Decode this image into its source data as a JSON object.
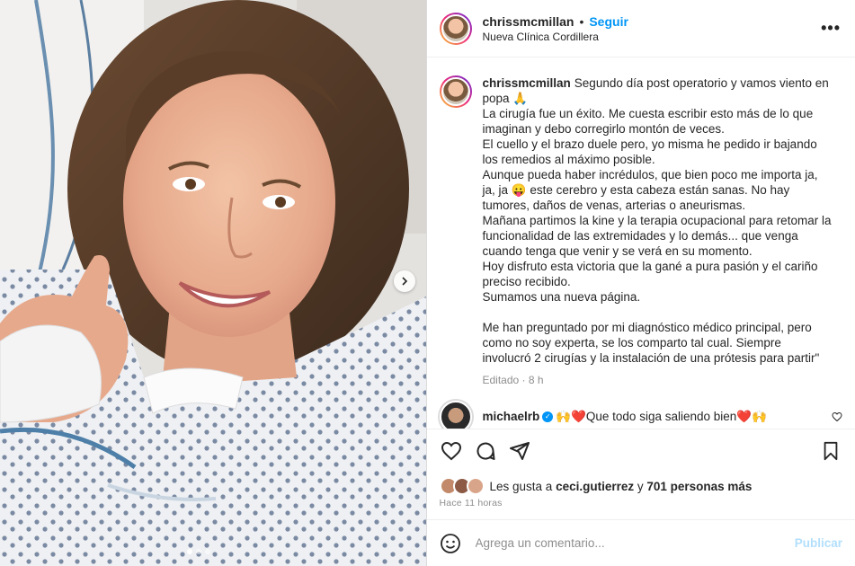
{
  "post": {
    "username": "chrissmcmillan",
    "separator": "•",
    "follow_label": "Seguir",
    "location": "Nueva Clínica Cordillera",
    "more_icon": "•••"
  },
  "caption": {
    "username": "chrissmcmillan",
    "paragraphs": [
      "Segundo día post operatorio y vamos viento en popa 🙏",
      "La cirugía fue un éxito. Me cuesta escribir esto más de lo que imaginan y debo corregirlo montón de veces.",
      "El cuello y el brazo duele pero, yo misma he pedido ir bajando los remedios al máximo posible.",
      "Aunque pueda haber incrédulos, que bien poco me importa ja, ja, ja 😛 este cerebro y esta cabeza están sanas. No hay tumores, daños de venas, arterias o aneurismas.",
      "Mañana partimos la kine y la terapia ocupacional para retomar la funcionalidad de las extremidades y lo demás... que venga cuando tenga que venir y se verá en su momento.",
      "Hoy disfruto esta victoria que la gané a pura pasión y el cariño preciso recibido.",
      "Sumamos una nueva página."
    ],
    "paragraphs2": [
      "Me han preguntado por mi diagnóstico médico principal, pero como no soy experta, se los comparto tal cual. Siempre involucró 2 cirugías y la instalación de una prótesis para partir\""
    ],
    "edited": "Editado · 8 h"
  },
  "comment": {
    "username": "michaelrb",
    "verified_icon": "✓",
    "text": "🙌❤️Que todo siga saliendo bien❤️🙌"
  },
  "likes": {
    "prefix": "Les gusta a ",
    "user": "ceci.gutierrez",
    "middle": " y ",
    "count": "701 personas más"
  },
  "time_ago": "Hace 11 horas",
  "add_comment": {
    "placeholder": "Agrega un comentario...",
    "publish_label": "Publicar"
  },
  "carousel": {
    "total_slides": 3,
    "active_slide": 1
  },
  "colors": {
    "follow": "#0095f6",
    "publish_disabled": "#b2dffc",
    "text": "#262626",
    "muted": "#8e8e8e"
  }
}
